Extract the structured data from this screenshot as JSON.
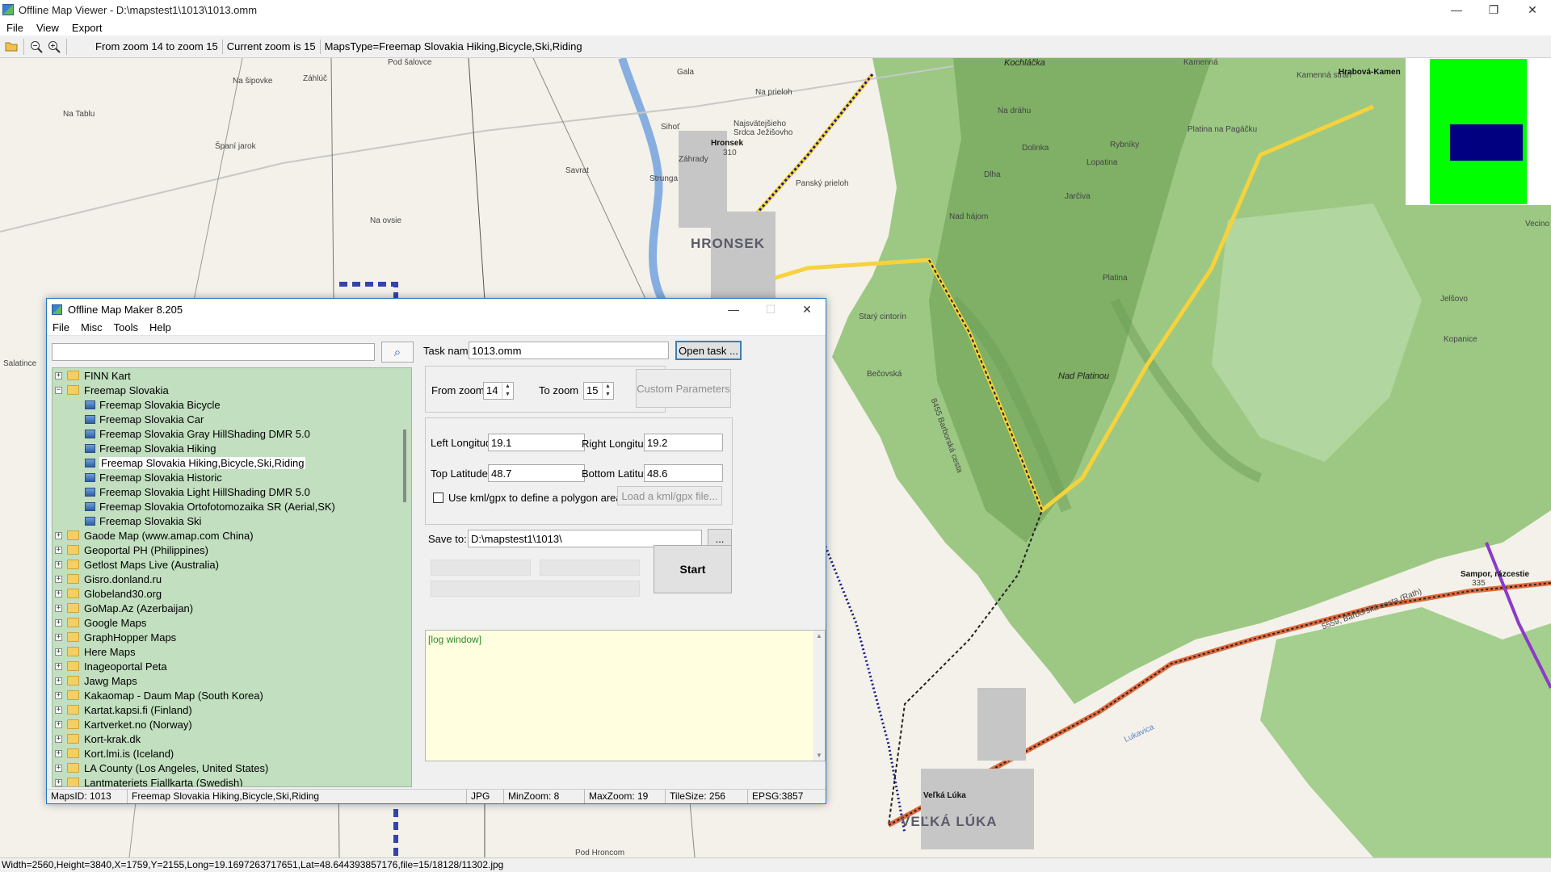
{
  "viewer": {
    "title": "Offline Map Viewer - D:\\mapstest1\\1013\\1013.omm",
    "menu": [
      "File",
      "View",
      "Export"
    ],
    "toolbar": {
      "zoom_range": "From zoom 14 to zoom 15",
      "current_zoom": "Current zoom is 15",
      "maps_type": "MapsType=Freemap Slovakia Hiking,Bicycle,Ski,Riding"
    },
    "status": "Width=2560,Height=3840,X=1759,Y=2155,Long=19.1697263717651,Lat=48.644393857176,file=15/18128/11302.jpg"
  },
  "map": {
    "labels": [
      {
        "text": "Pod šalovce",
        "kind": "normal"
      },
      {
        "text": "Záhlúč",
        "kind": "normal"
      },
      {
        "text": "Na šipovke",
        "kind": "normal"
      },
      {
        "text": "Na Tablu",
        "kind": "normal"
      },
      {
        "text": "Španí jarok",
        "kind": "normal"
      },
      {
        "text": "Na ovsie",
        "kind": "normal"
      },
      {
        "text": "Savrat",
        "kind": "normal"
      },
      {
        "text": "Gala",
        "kind": "normal"
      },
      {
        "text": "Na prieloh",
        "kind": "normal"
      },
      {
        "text": "Sihoť",
        "kind": "normal"
      },
      {
        "text": "Záhrady",
        "kind": "normal"
      },
      {
        "text": "Strunga",
        "kind": "normal"
      },
      {
        "text": "Najsvätejšieho Srdca Ježišovho",
        "kind": "normal"
      },
      {
        "text": "Hronsek",
        "kind": "bold"
      },
      {
        "text": "310",
        "kind": "normal"
      },
      {
        "text": "HRONSEK",
        "kind": "big"
      },
      {
        "text": "Panský prieloh",
        "kind": "normal"
      },
      {
        "text": "Starý cintorín",
        "kind": "normal"
      },
      {
        "text": "Kochláčka",
        "kind": "italic"
      },
      {
        "text": "Kamenná",
        "kind": "normal"
      },
      {
        "text": "Kamenná stráň",
        "kind": "normal"
      },
      {
        "text": "Hrabová-Kamen",
        "kind": "bold"
      },
      {
        "text": "Na dráhu",
        "kind": "normal"
      },
      {
        "text": "Rybníky",
        "kind": "normal"
      },
      {
        "text": "Dolinka",
        "kind": "normal"
      },
      {
        "text": "Platina na Pagáčku",
        "kind": "normal"
      },
      {
        "text": "Lopatina",
        "kind": "normal"
      },
      {
        "text": "Dlha",
        "kind": "normal"
      },
      {
        "text": "Jarčiva",
        "kind": "normal"
      },
      {
        "text": "Nad hájom",
        "kind": "normal"
      },
      {
        "text": "Platina",
        "kind": "normal"
      },
      {
        "text": "Jelšovo",
        "kind": "normal"
      },
      {
        "text": "Kopanice",
        "kind": "normal"
      },
      {
        "text": "Bečovská",
        "kind": "normal"
      },
      {
        "text": "Nad Platinou",
        "kind": "italic"
      },
      {
        "text": "Sampor, rázcestie",
        "kind": "bold"
      },
      {
        "text": "335",
        "kind": "normal"
      },
      {
        "text": "Veľká Lúka",
        "kind": "bold"
      },
      {
        "text": "VEĽKÁ LÚKA",
        "kind": "big"
      },
      {
        "text": "Pod Hroncom",
        "kind": "normal"
      },
      {
        "text": "Salatince",
        "kind": "normal"
      },
      {
        "text": "Vecino",
        "kind": "normal"
      },
      {
        "text": "8455 Barborská cesta",
        "kind": "normal"
      },
      {
        "text": "5559, Barborská cesta (Rath)",
        "kind": "normal"
      },
      {
        "text": "Lukavica",
        "kind": "normal"
      }
    ]
  },
  "dialog": {
    "title": "Offline Map Maker 8.205",
    "menu": [
      "File",
      "Misc",
      "Tools",
      "Help"
    ],
    "search_value": "",
    "tree": [
      {
        "label": "FINN Kart",
        "type": "folder",
        "expanded": false
      },
      {
        "label": "Freemap Slovakia",
        "type": "folder",
        "expanded": true
      },
      {
        "label": "Freemap Slovakia Bicycle",
        "type": "map"
      },
      {
        "label": "Freemap Slovakia Car",
        "type": "map"
      },
      {
        "label": "Freemap Slovakia Gray HillShading DMR 5.0",
        "type": "map"
      },
      {
        "label": "Freemap Slovakia Hiking",
        "type": "map"
      },
      {
        "label": "Freemap Slovakia Hiking,Bicycle,Ski,Riding",
        "type": "map",
        "selected": true
      },
      {
        "label": "Freemap Slovakia Historic",
        "type": "map"
      },
      {
        "label": "Freemap Slovakia Light HillShading DMR 5.0",
        "type": "map"
      },
      {
        "label": "Freemap Slovakia Ortofotomozaika SR (Aerial,SK)",
        "type": "map"
      },
      {
        "label": "Freemap Slovakia Ski",
        "type": "map"
      },
      {
        "label": "Gaode Map (www.amap.com China)",
        "type": "folder",
        "expanded": false
      },
      {
        "label": "Geoportal PH (Philippines)",
        "type": "folder",
        "expanded": false
      },
      {
        "label": "Getlost Maps Live (Australia)",
        "type": "folder",
        "expanded": false
      },
      {
        "label": "Gisro.donland.ru",
        "type": "folder",
        "expanded": false
      },
      {
        "label": "Globeland30.org",
        "type": "folder",
        "expanded": false
      },
      {
        "label": "GoMap.Az (Azerbaijan)",
        "type": "folder",
        "expanded": false
      },
      {
        "label": "Google Maps",
        "type": "folder",
        "expanded": false
      },
      {
        "label": "GraphHopper Maps",
        "type": "folder",
        "expanded": false
      },
      {
        "label": "Here Maps",
        "type": "folder",
        "expanded": false
      },
      {
        "label": "Inageoportal Peta",
        "type": "folder",
        "expanded": false
      },
      {
        "label": "Jawg Maps",
        "type": "folder",
        "expanded": false
      },
      {
        "label": "Kakaomap - Daum Map (South Korea)",
        "type": "folder",
        "expanded": false
      },
      {
        "label": "Kartat.kapsi.fi (Finland)",
        "type": "folder",
        "expanded": false
      },
      {
        "label": "Kartverket.no (Norway)",
        "type": "folder",
        "expanded": false
      },
      {
        "label": "Kort-krak.dk",
        "type": "folder",
        "expanded": false
      },
      {
        "label": "Kort.lmi.is (Iceland)",
        "type": "folder",
        "expanded": false
      },
      {
        "label": "LA County (Los Angeles, United States)",
        "type": "folder",
        "expanded": false
      },
      {
        "label": "Lantmateriets Fjallkarta (Swedish)",
        "type": "folder",
        "expanded": false
      }
    ],
    "task": {
      "task_name_label": "Task name",
      "task_name_value": "1013.omm",
      "open_task": "Open task ...",
      "from_zoom_label": "From zoom",
      "from_zoom_value": "14",
      "to_zoom_label": "To zoom",
      "to_zoom_value": "15",
      "custom_params": "Custom Parameters",
      "left_lon_label": "Left Longitude",
      "left_lon_value": "19.1",
      "right_lon_label": "Right Longitude",
      "right_lon_value": "19.2",
      "top_lat_label": "Top Latitude",
      "top_lat_value": "48.7",
      "bottom_lat_label": "Bottom Latitude",
      "bottom_lat_value": "48.6",
      "kml_label": "Use kml/gpx to define a polygon area",
      "load_kml": "Load a kml/gpx file...",
      "save_to_label": "Save to:",
      "save_to_value": "D:\\mapstest1\\1013\\",
      "browse": "...",
      "start": "Start",
      "log": "[log window]"
    },
    "status": {
      "maps_id": "MapsID: 1013",
      "name": "Freemap Slovakia Hiking,Bicycle,Ski,Riding",
      "format": "JPG",
      "min_zoom": "MinZoom: 8",
      "max_zoom": "MaxZoom: 19",
      "tile_size": "TileSize: 256",
      "epsg": "EPSG:3857"
    }
  },
  "colors": {
    "tree_bg": "#c2dfc0",
    "log_bg": "#ffffe0",
    "overview_green": "#00ff00",
    "overview_navy": "#000080",
    "forest": "#8dbb74"
  }
}
